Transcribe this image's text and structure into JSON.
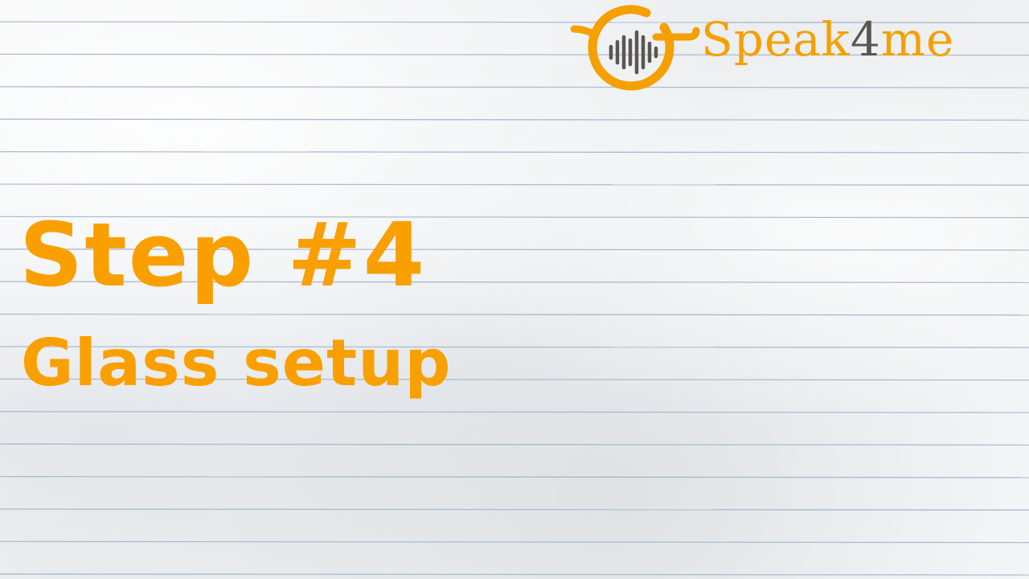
{
  "logo": {
    "brand_prefix": "Speak",
    "brand_number": "4",
    "brand_suffix": "me",
    "icon": "sound-wave-icon"
  },
  "heading": {
    "title": "Step #4",
    "subtitle": "Glass setup"
  },
  "colors": {
    "accent": "#f9a000",
    "logo_gray": "#5b5651",
    "paper": "#f1f3f4",
    "rule_line": "#9fb2cc"
  }
}
